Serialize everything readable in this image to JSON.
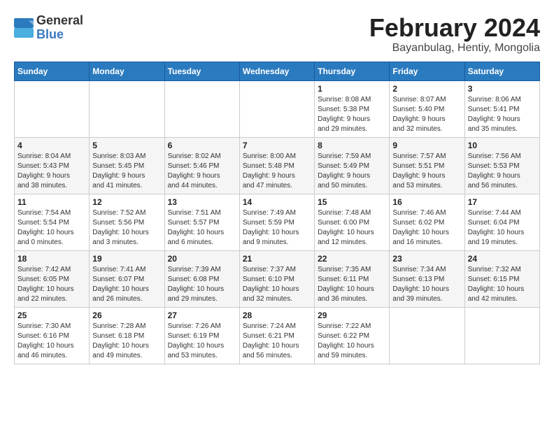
{
  "logo": {
    "text_general": "General",
    "text_blue": "Blue"
  },
  "title": {
    "month_year": "February 2024",
    "location": "Bayanbulag, Hentiy, Mongolia"
  },
  "headers": [
    "Sunday",
    "Monday",
    "Tuesday",
    "Wednesday",
    "Thursday",
    "Friday",
    "Saturday"
  ],
  "weeks": [
    [
      {
        "day": "",
        "info": ""
      },
      {
        "day": "",
        "info": ""
      },
      {
        "day": "",
        "info": ""
      },
      {
        "day": "",
        "info": ""
      },
      {
        "day": "1",
        "info": "Sunrise: 8:08 AM\nSunset: 5:38 PM\nDaylight: 9 hours\nand 29 minutes."
      },
      {
        "day": "2",
        "info": "Sunrise: 8:07 AM\nSunset: 5:40 PM\nDaylight: 9 hours\nand 32 minutes."
      },
      {
        "day": "3",
        "info": "Sunrise: 8:06 AM\nSunset: 5:41 PM\nDaylight: 9 hours\nand 35 minutes."
      }
    ],
    [
      {
        "day": "4",
        "info": "Sunrise: 8:04 AM\nSunset: 5:43 PM\nDaylight: 9 hours\nand 38 minutes."
      },
      {
        "day": "5",
        "info": "Sunrise: 8:03 AM\nSunset: 5:45 PM\nDaylight: 9 hours\nand 41 minutes."
      },
      {
        "day": "6",
        "info": "Sunrise: 8:02 AM\nSunset: 5:46 PM\nDaylight: 9 hours\nand 44 minutes."
      },
      {
        "day": "7",
        "info": "Sunrise: 8:00 AM\nSunset: 5:48 PM\nDaylight: 9 hours\nand 47 minutes."
      },
      {
        "day": "8",
        "info": "Sunrise: 7:59 AM\nSunset: 5:49 PM\nDaylight: 9 hours\nand 50 minutes."
      },
      {
        "day": "9",
        "info": "Sunrise: 7:57 AM\nSunset: 5:51 PM\nDaylight: 9 hours\nand 53 minutes."
      },
      {
        "day": "10",
        "info": "Sunrise: 7:56 AM\nSunset: 5:53 PM\nDaylight: 9 hours\nand 56 minutes."
      }
    ],
    [
      {
        "day": "11",
        "info": "Sunrise: 7:54 AM\nSunset: 5:54 PM\nDaylight: 10 hours\nand 0 minutes."
      },
      {
        "day": "12",
        "info": "Sunrise: 7:52 AM\nSunset: 5:56 PM\nDaylight: 10 hours\nand 3 minutes."
      },
      {
        "day": "13",
        "info": "Sunrise: 7:51 AM\nSunset: 5:57 PM\nDaylight: 10 hours\nand 6 minutes."
      },
      {
        "day": "14",
        "info": "Sunrise: 7:49 AM\nSunset: 5:59 PM\nDaylight: 10 hours\nand 9 minutes."
      },
      {
        "day": "15",
        "info": "Sunrise: 7:48 AM\nSunset: 6:00 PM\nDaylight: 10 hours\nand 12 minutes."
      },
      {
        "day": "16",
        "info": "Sunrise: 7:46 AM\nSunset: 6:02 PM\nDaylight: 10 hours\nand 16 minutes."
      },
      {
        "day": "17",
        "info": "Sunrise: 7:44 AM\nSunset: 6:04 PM\nDaylight: 10 hours\nand 19 minutes."
      }
    ],
    [
      {
        "day": "18",
        "info": "Sunrise: 7:42 AM\nSunset: 6:05 PM\nDaylight: 10 hours\nand 22 minutes."
      },
      {
        "day": "19",
        "info": "Sunrise: 7:41 AM\nSunset: 6:07 PM\nDaylight: 10 hours\nand 26 minutes."
      },
      {
        "day": "20",
        "info": "Sunrise: 7:39 AM\nSunset: 6:08 PM\nDaylight: 10 hours\nand 29 minutes."
      },
      {
        "day": "21",
        "info": "Sunrise: 7:37 AM\nSunset: 6:10 PM\nDaylight: 10 hours\nand 32 minutes."
      },
      {
        "day": "22",
        "info": "Sunrise: 7:35 AM\nSunset: 6:11 PM\nDaylight: 10 hours\nand 36 minutes."
      },
      {
        "day": "23",
        "info": "Sunrise: 7:34 AM\nSunset: 6:13 PM\nDaylight: 10 hours\nand 39 minutes."
      },
      {
        "day": "24",
        "info": "Sunrise: 7:32 AM\nSunset: 6:15 PM\nDaylight: 10 hours\nand 42 minutes."
      }
    ],
    [
      {
        "day": "25",
        "info": "Sunrise: 7:30 AM\nSunset: 6:16 PM\nDaylight: 10 hours\nand 46 minutes."
      },
      {
        "day": "26",
        "info": "Sunrise: 7:28 AM\nSunset: 6:18 PM\nDaylight: 10 hours\nand 49 minutes."
      },
      {
        "day": "27",
        "info": "Sunrise: 7:26 AM\nSunset: 6:19 PM\nDaylight: 10 hours\nand 53 minutes."
      },
      {
        "day": "28",
        "info": "Sunrise: 7:24 AM\nSunset: 6:21 PM\nDaylight: 10 hours\nand 56 minutes."
      },
      {
        "day": "29",
        "info": "Sunrise: 7:22 AM\nSunset: 6:22 PM\nDaylight: 10 hours\nand 59 minutes."
      },
      {
        "day": "",
        "info": ""
      },
      {
        "day": "",
        "info": ""
      }
    ]
  ]
}
